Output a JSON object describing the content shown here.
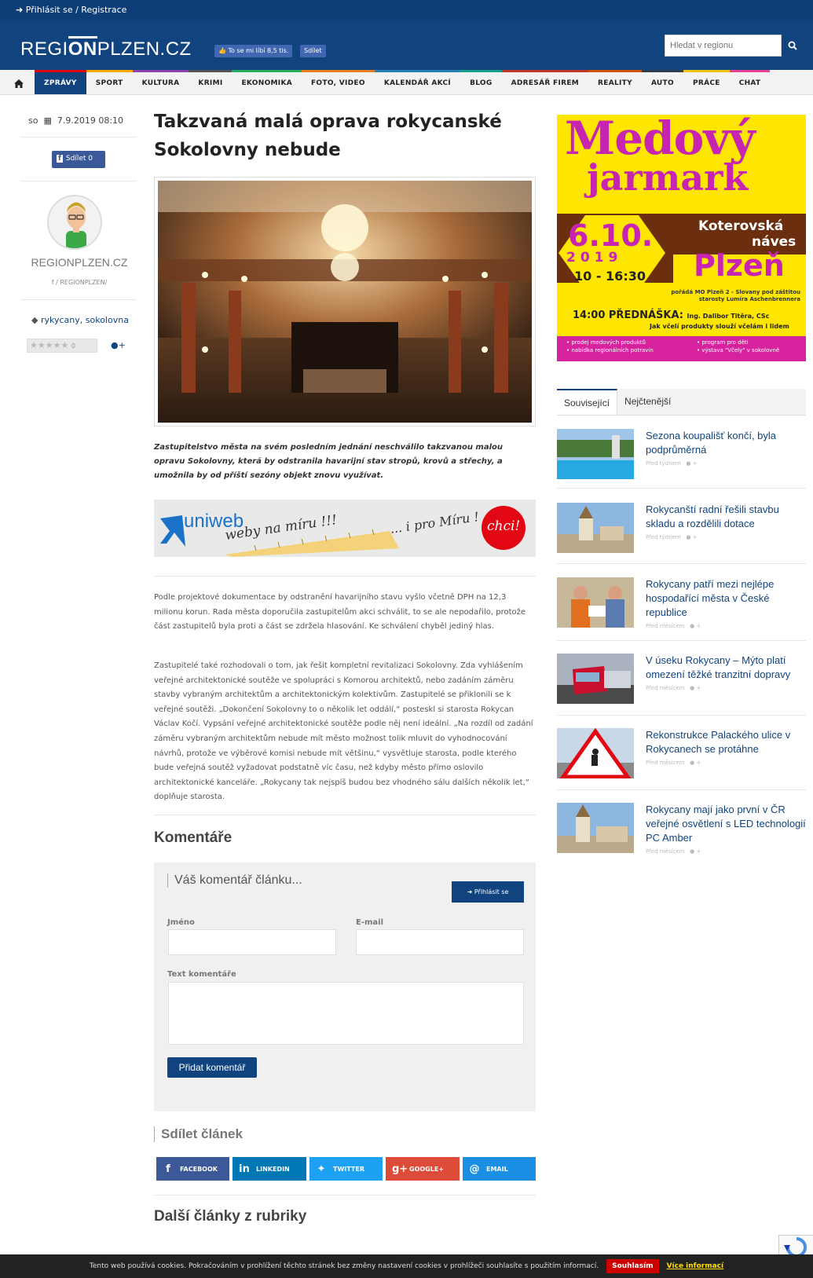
{
  "topbar": {
    "login_text": "Přihlásit se / Registrace"
  },
  "header": {
    "logo_region": "REGI",
    "logo_on": "ON",
    "logo_rest": "PLZEN.CZ",
    "fb_like": "To se mi líbí 8,5 tis.",
    "fb_share": "Sdílet",
    "search_placeholder": "Hledat v regionu"
  },
  "nav": {
    "items": [
      "ZPRÁVY",
      "SPORT",
      "KULTURA",
      "KRIMI",
      "EKONOMIKA",
      "FOTO, VIDEO",
      "KALENDÁŘ AKCÍ",
      "BLOG",
      "ADRESÁŘ FIREM",
      "REALITY",
      "AUTO",
      "PRÁCE",
      "CHAT"
    ],
    "active": "ZPRÁVY"
  },
  "article": {
    "day": "so",
    "date": "7.9.2019 08:10",
    "share_label": "Sdílet",
    "share_count": "0",
    "author_name": "REGIONPLZEN.CZ",
    "author_link": "/ REGIONPLZEN/",
    "tags": "rykycany, sokolovna",
    "title": "Takzvaná malá oprava rokycanské Sokolovny nebude",
    "perex": "Zastupitelstvo města na svém posledním jednání neschválilo takzvanou malou opravu Sokolovny, která by odstranila havarijní stav stropů, krovů a střechy, a umožnila by od příští sezóny objekt znovu využívat.",
    "paragraph1": "Podle projektové dokumentace by odstranění havarijního stavu vyšlo včetně DPH na 12,3 milionu korun. Rada města doporučila zastupitelům akci schválit, to se ale nepodařilo, protože část zastupitelů byla proti a část se zdržela hlasování. Ke schválení chyběl jediný hlas.",
    "paragraph2": "Zastupitelé také rozhodovali o tom, jak řešit kompletní revitalizaci Sokolovny. Zda vyhlášením veřejné architektonické soutěže ve spolupráci s Komorou architektů, nebo zadáním záměru stavby vybraným architektům a architektonickým kolektivům. Zastupitelé se přiklonili se k veřejné soutěži. „Dokončení Sokolovny to o několik let oddálí,“ posteskl si starosta Rokycan Václav Kočí. Vypsání veřejné architektonické soutěže podle něj není ideální. „Na rozdíl od zadání záměru vybraným architektům nebude mít město možnost tolik mluvit do vyhodnocování návrhů, protože ve výběrové komisi nebude mít většinu,“ vysvětluje starosta, podle kterého bude veřejná soutěž vyžadovat podstatně víc času, než kdyby město přímo oslovilo architektonické kanceláře. „Rokycany tak nejspíš budou bez vhodného sálu dalších několik let,“ doplňuje starosta."
  },
  "banner": {
    "brand": "uniweb",
    "slogan1": "weby na míru !!!",
    "slogan2": "... i pro Míru !",
    "cta": "chci!"
  },
  "comments": {
    "heading": "Komentáře",
    "form_title": "Váš komentář článku...",
    "login_button": "Přihlásit se",
    "name_label": "Jméno",
    "email_label": "E-mail",
    "text_label": "Text komentáře",
    "submit_label": "Přidat komentář"
  },
  "share": {
    "heading": "Sdílet článek",
    "buttons": [
      {
        "label": "FACEBOOK",
        "icon": "f",
        "color": "#3b5998"
      },
      {
        "label": "LINKEDIN",
        "icon": "in",
        "color": "#0077b5"
      },
      {
        "label": "TWITTER",
        "icon": "t",
        "color": "#1da1f2"
      },
      {
        "label": "GOOGLE+",
        "icon": "g+",
        "color": "#dd4b39"
      },
      {
        "label": "EMAIL",
        "icon": "@",
        "color": "#1a8fe3"
      }
    ]
  },
  "more": {
    "heading": "Další články z rubriky"
  },
  "ad": {
    "line1": "Medový",
    "line2": "jarmark",
    "place1": "Koterovská",
    "place2": "náves",
    "date": "6.10.",
    "year": "2019",
    "time": "10 - 16:30",
    "city": "Plzeň",
    "organizer": "pořádá MO Plzeň 2 - Slovany pod záštitou starosty Lumíra Aschenbrennera",
    "lecture_label": "14:00 PŘEDNÁŠKA:",
    "lecturer": "Ing. Dalibor Titěra, CSc",
    "lecture_topic": "Jak včelí produkty slouží včelám i lidem",
    "b1": "• prodej medových produktů",
    "b2": "• nabídka regionálních potravin",
    "b3": "• program pro děti",
    "b4": "• výstava \"Včely\" v sokolovně"
  },
  "tabs": {
    "related": "Související",
    "newest": "Nejčtenější"
  },
  "related": [
    {
      "title": "Sezona koupališť končí, byla podprůměrná",
      "meta": "Před týdnem"
    },
    {
      "title": "Rokycanští radní řešili stavbu skladu a rozdělili dotace",
      "meta": "Před týdnem"
    },
    {
      "title": "Rokycany patří mezi nejlépe hospodařící města v České republice",
      "meta": "Před měsícem"
    },
    {
      "title": "V úseku Rokycany – Mýto platí omezení těžké tranzitní dopravy",
      "meta": "Před měsícem"
    },
    {
      "title": "Rekonstrukce Palackého ulice v Rokycanech se protáhne",
      "meta": "Před měsícem"
    },
    {
      "title": "Rokycany mají jako první v ČR veřejné osvětlení s LED technologií PC Amber",
      "meta": "Před měsícem"
    }
  ],
  "cookie": {
    "text": "Tento web používá cookies. Pokračováním v prohlížení těchto stránek bez změny nastavení cookies v prohlížeči souhlasíte s použitím informací.",
    "agree": "Souhlasím",
    "more": "Více informací"
  }
}
